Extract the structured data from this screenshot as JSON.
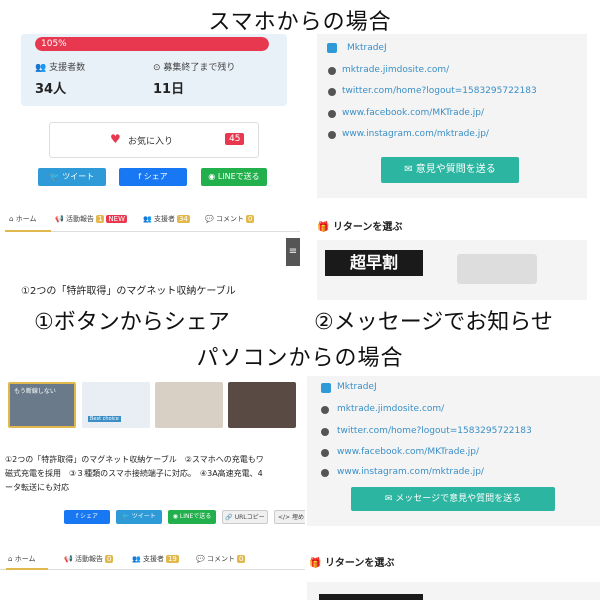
{
  "headings": {
    "phone": "スマホからの場合",
    "pc": "パソコンからの場合"
  },
  "captions": {
    "share": "①ボタンからシェア",
    "message": "②メッセージでお知らせ"
  },
  "phone_left": {
    "progress": {
      "label": "105%",
      "value": 105,
      "color": "#e8384f"
    },
    "supporters_label": "支援者数",
    "supporters_value": "34人",
    "deadline_label": "募集終了まで残り",
    "deadline_value": "11日",
    "favorite_label": "お気に入り",
    "favorite_count": "45",
    "share_buttons": {
      "tweet": "ツイート",
      "share": "シェア",
      "line": "LINEで送る"
    },
    "tabs": {
      "home": "ホーム",
      "activity": "活動報告",
      "activity_badge": "1",
      "new_badge": "NEW",
      "supporters": "支援者",
      "supporters_badge": "34",
      "comment": "コメント",
      "comment_badge": "0"
    },
    "menu_icon": "≡",
    "desc_line1": "①2つの「特許取得」のマグネット収納ケーブル"
  },
  "phone_right": {
    "twitter_name": "MktradeJ",
    "links": [
      "mktrade.jimdosite.com/",
      "twitter.com/home?logout=1583295722183",
      "www.facebook.com/MKTrade.jp/",
      "www.instagram.com/mktrade.jp/"
    ],
    "message_button": "意見や質問を送る",
    "return_title": "リターンを選ぶ",
    "banner": "超早割"
  },
  "pc_left": {
    "thumb_label": "もう断線しない",
    "thumb_label2": "Best choice",
    "desc_lines": [
      "①2つの「特許取得」のマグネット収納ケーブル　②スマホへの充電もワ",
      "磁式充電を採用　③３種類のスマホ接続端子に対応。　④3A高速充電、4",
      "ータ転送にも対応"
    ],
    "buttons": {
      "share": "シェア",
      "tweet": "ツイート",
      "line": "LINEで送る",
      "url": "URLコピー",
      "embed": "埋め"
    },
    "tabs": {
      "home": "ホーム",
      "activity": "活動報告",
      "activity_badge": "0",
      "supporters": "支援者",
      "supporters_badge": "19",
      "comment": "コメント",
      "comment_badge": "0"
    }
  },
  "pc_right": {
    "twitter_name": "MktradeJ",
    "links": [
      "mktrade.jimdosite.com/",
      "twitter.com/home?logout=1583295722183",
      "www.facebook.com/MKTrade.jp/",
      "www.instagram.com/mktrade.jp/"
    ],
    "message_button": "メッセージで意見や質問を送る",
    "return_title": "リターンを選ぶ"
  },
  "colors": {
    "twitter": "#2e9ad8",
    "facebook": "#1877f2",
    "line": "#21b04b",
    "teal": "#2cb5a0",
    "red": "#e8384f",
    "gold": "#e0b84c"
  }
}
